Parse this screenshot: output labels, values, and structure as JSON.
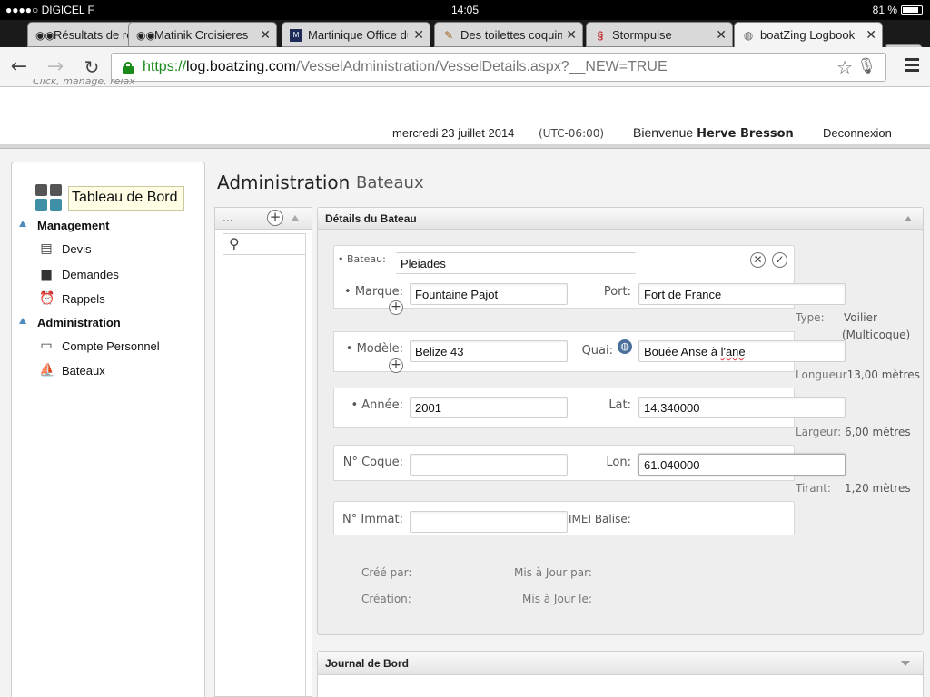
{
  "status_bar": {
    "carrier": "●●●●○ DIGICEL F",
    "time": "14:05",
    "battery": "81 %"
  },
  "tabs": [
    {
      "title": "Résultats de re",
      "icon": "tripadvisor-owl-icon"
    },
    {
      "title": "Matinik Croisieres -",
      "icon": "tripadvisor-owl-icon"
    },
    {
      "title": "Martinique Office du",
      "icon": "martinique-office-icon"
    },
    {
      "title": "Des toilettes coquine",
      "icon": "pencil-icon"
    },
    {
      "title": "Stormpulse",
      "icon": "stormpulse-icon"
    },
    {
      "title": "boatZing Logbook",
      "icon": "globe-icon"
    }
  ],
  "url": {
    "scheme": "https://",
    "host": "log.boatzing.com",
    "path": "/VesselAdministration/VesselDetails.aspx?__NEW=TRUE"
  },
  "header": {
    "tagline": "Click, manage, relax",
    "date": "mercredi 23 juillet 2014",
    "timezone": "(UTC-06:00)",
    "welcome": "Bienvenue",
    "user": "Herve Bresson",
    "logout": "Deconnexion"
  },
  "sidebar": {
    "dashboard": "Tableau de Bord",
    "sections": [
      {
        "label": "Management",
        "items": [
          "Devis",
          "Demandes",
          "Rappels"
        ]
      },
      {
        "label": "Administration",
        "items": [
          "Compte Personnel",
          "Bateaux"
        ]
      }
    ]
  },
  "main": {
    "title": "Administration",
    "subtitle": "Bateaux",
    "list_header": "...",
    "details_title": "Détails du Bateau",
    "journal_title": "Journal de Bord"
  },
  "form": {
    "bateau_label": "• Bateau:",
    "bateau": "Pleiades",
    "marque_label": "• Marque:",
    "marque": "Fountaine Pajot",
    "modele_label": "• Modèle:",
    "modele": "Belize 43",
    "annee_label": "• Année:",
    "annee": "2001",
    "coque_label": "N° Coque:",
    "coque": "",
    "immat_label": "N° Immat:",
    "immat": "",
    "port_label": "Port:",
    "port": "Fort de France",
    "quai_label": "Quai:",
    "quai_prefix": "Bouée Anse à ",
    "quai_suffix": "l'ane",
    "lat_label": "Lat:",
    "lat": "14.340000",
    "lon_label": "Lon:",
    "lon": "61.040000",
    "imei_label": "IMEI Balise:"
  },
  "info": {
    "type_label": "Type:",
    "type_value": "Voilier",
    "type_sub": "(Multicoque)",
    "longueur_label": "Longueur",
    "longueur_value": "13,00 mètres",
    "largeur_label": "Largeur:",
    "largeur_value": "6,00 mètres",
    "tirant_label": "Tirant:",
    "tirant_value": "1,20 mètres"
  },
  "meta": {
    "cree_par": "Créé par:",
    "creation": "Création:",
    "maj_par": "Mis à Jour par:",
    "maj_le": "Mis à Jour le:"
  },
  "colors": {
    "accent": "#4a8bc0",
    "dash_dark": "#555555",
    "dash_teal": "#3f8fa6",
    "https_green": "#1a8a1a"
  }
}
